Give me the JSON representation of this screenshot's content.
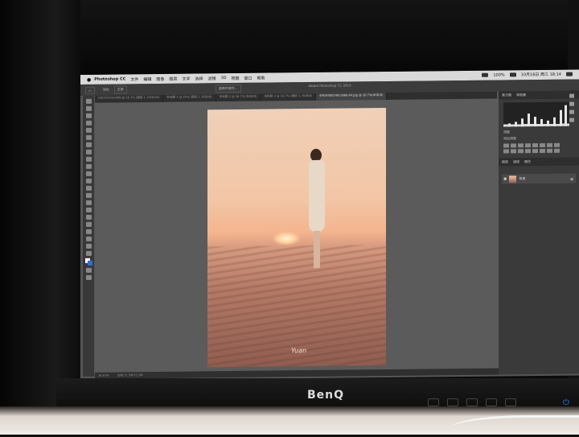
{
  "menubar": {
    "app_name": "Photoshop CC",
    "items": [
      "文件",
      "编辑",
      "图像",
      "图层",
      "文字",
      "选择",
      "滤镜",
      "3D",
      "视图",
      "窗口",
      "帮助"
    ],
    "clock": "10月16日 周三 18:14",
    "battery": "100%"
  },
  "window": {
    "title": "Adobe Photoshop CC 2019"
  },
  "options_bar": {
    "mode_label": "正常",
    "opacity_label": "不透明度",
    "feather_label": "羽化",
    "select_mask_label": "选择并遮住..."
  },
  "tabs": [
    {
      "label": "DSC01434.ARW @ 16.7% (图层 1, RGB/16)",
      "active": false
    },
    {
      "label": "未标题-1 @ 25% (图层 1, RGB/8)",
      "active": false
    },
    {
      "label": "未标题-2 @ 16.7% (RGB/8)",
      "active": false
    },
    {
      "label": "未标题-3 @ 16.7% (图层 1, RGB/8)",
      "active": false
    },
    {
      "label": "4f924480148c586b-04.jpg @ 16.7%(RGB/8)",
      "active": true
    }
  ],
  "status": {
    "zoom": "16.67%",
    "doc_size": "文档:71.5M/71.5M"
  },
  "panels": {
    "histogram_tab": "直方图",
    "navigator_tab": "导航器",
    "adjustments_label": "调整",
    "add_adjustment_label": "添加调整",
    "layers_tab": "图层",
    "channels_tab": "通道",
    "paths_tab": "路径",
    "layer_name": "背景"
  },
  "canvas": {
    "signature": "Yuan"
  },
  "monitor": {
    "brand": "BenQ"
  }
}
